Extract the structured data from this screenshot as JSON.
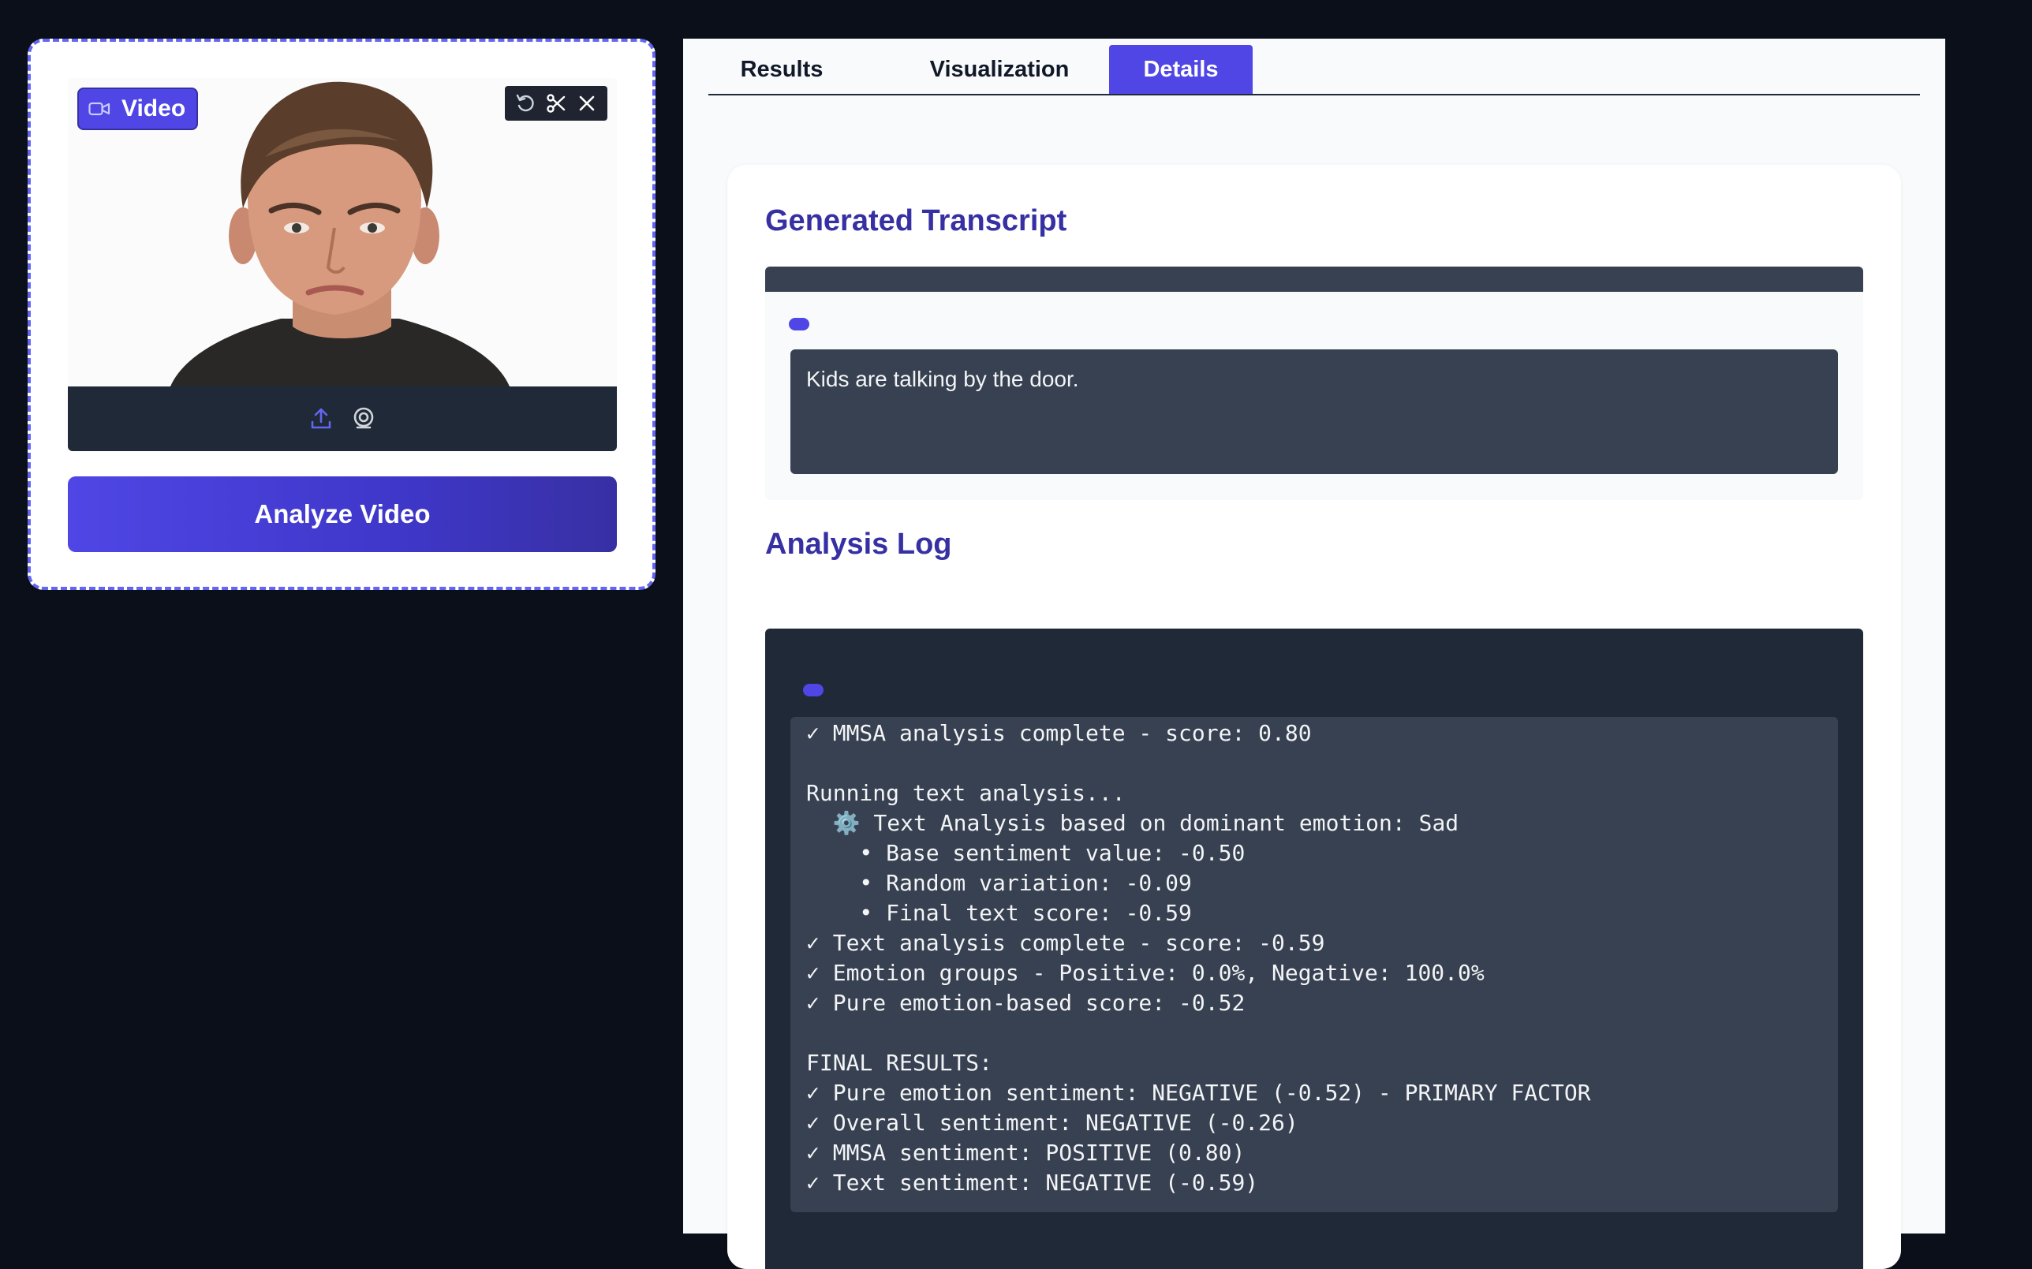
{
  "left_card": {
    "video_label": "Video",
    "analyze_label": "Analyze Video"
  },
  "tabs": [
    {
      "label": "Results"
    },
    {
      "label": "Visualization"
    },
    {
      "label": "Details"
    }
  ],
  "active_tab": "Details",
  "transcript": {
    "title": "Generated Transcript",
    "text": "Kids are talking by the door."
  },
  "analysis_log": {
    "title": "Analysis Log",
    "lines": [
      "✓ MMSA analysis complete - score: 0.80",
      "",
      "Running text analysis...",
      "  ⚙️ Text Analysis based on dominant emotion: Sad",
      "    • Base sentiment value: -0.50",
      "    • Random variation: -0.09",
      "    • Final text score: -0.59",
      "✓ Text analysis complete - score: -0.59",
      "✓ Emotion groups - Positive: 0.0%, Negative: 100.0%",
      "✓ Pure emotion-based score: -0.52",
      "",
      "FINAL RESULTS:",
      "✓ Pure emotion sentiment: NEGATIVE (-0.52) - PRIMARY FACTOR",
      "✓ Overall sentiment: NEGATIVE (-0.26)",
      "✓ MMSA sentiment: POSITIVE (0.80)",
      "✓ Text sentiment: NEGATIVE (-0.59)"
    ]
  },
  "colors": {
    "accent": "#4f46e5",
    "title": "#3730a3",
    "background": "#0b0f19",
    "log_bg": "#1f2937",
    "text_area_bg": "#374151"
  }
}
